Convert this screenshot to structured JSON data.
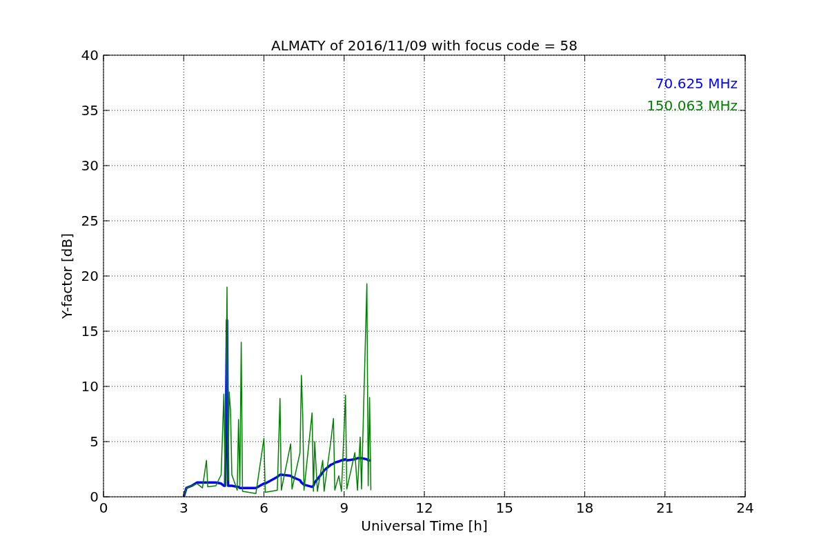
{
  "chart_data": {
    "type": "line",
    "title": "ALMATY of 2016/11/09 with focus code = 58",
    "xlabel": "Universal Time [h]",
    "ylabel": "Y-factor [dB]",
    "x": [
      3.0,
      3.1,
      3.3,
      3.5,
      3.7,
      3.85,
      3.9,
      4.2,
      4.4,
      4.5,
      4.55,
      4.62,
      4.66,
      4.7,
      4.75,
      4.8,
      5.0,
      5.05,
      5.1,
      5.15,
      5.2,
      5.7,
      6.0,
      6.05,
      6.5,
      6.6,
      6.65,
      7.0,
      7.05,
      7.35,
      7.4,
      7.45,
      7.5,
      7.8,
      7.85,
      7.9,
      8.0,
      8.2,
      8.25,
      8.5,
      8.6,
      8.65,
      8.8,
      8.9,
      9.05,
      9.1,
      9.4,
      9.5,
      9.6,
      9.65,
      9.85,
      9.9,
      9.95,
      10.0
    ],
    "series": [
      {
        "name": "70.625 MHz",
        "color": "#0000ff",
        "values": [
          0,
          0.8,
          1.0,
          1.3,
          1.3,
          1.3,
          1.3,
          1.3,
          1.2,
          1.0,
          1.0,
          16.0,
          1.0,
          1.0,
          1.0,
          1.0,
          0.9,
          0.9,
          0.8,
          0.8,
          0.8,
          0.8,
          1.2,
          1.2,
          1.8,
          2.0,
          2.0,
          1.9,
          1.8,
          1.5,
          1.3,
          1.2,
          1.1,
          0.9,
          1.0,
          1.3,
          1.6,
          2.2,
          2.4,
          2.9,
          3.0,
          3.1,
          3.2,
          3.3,
          3.4,
          3.3,
          3.4,
          3.5,
          3.5,
          3.5,
          3.4,
          3.3,
          3.3,
          3.3
        ]
      },
      {
        "name": "150.063 MHz",
        "color": "#008000",
        "values": [
          0,
          0.8,
          1.0,
          1.2,
          0.8,
          3.3,
          0.9,
          1.0,
          2.0,
          9.3,
          1.0,
          19.0,
          1.5,
          9.5,
          7.8,
          2.0,
          0.6,
          7.0,
          1.0,
          14.0,
          0.5,
          0.3,
          5.3,
          0.4,
          0.6,
          8.9,
          0.6,
          4.8,
          0.7,
          4.0,
          11.0,
          7.5,
          0.6,
          7.6,
          0.5,
          5.0,
          0.5,
          3.3,
          0.5,
          5.0,
          7.1,
          0.6,
          1.9,
          0.5,
          9.2,
          0.7,
          4.0,
          0.6,
          5.4,
          0.7,
          19.3,
          1.0,
          9.0,
          0.6
        ]
      }
    ],
    "grid": true,
    "xlim": [
      0,
      24
    ],
    "ylim": [
      0,
      40
    ],
    "xticks": [
      0,
      3,
      6,
      9,
      12,
      15,
      18,
      21,
      24
    ],
    "yticks": [
      0,
      5,
      10,
      15,
      20,
      25,
      30,
      35,
      40
    ]
  }
}
